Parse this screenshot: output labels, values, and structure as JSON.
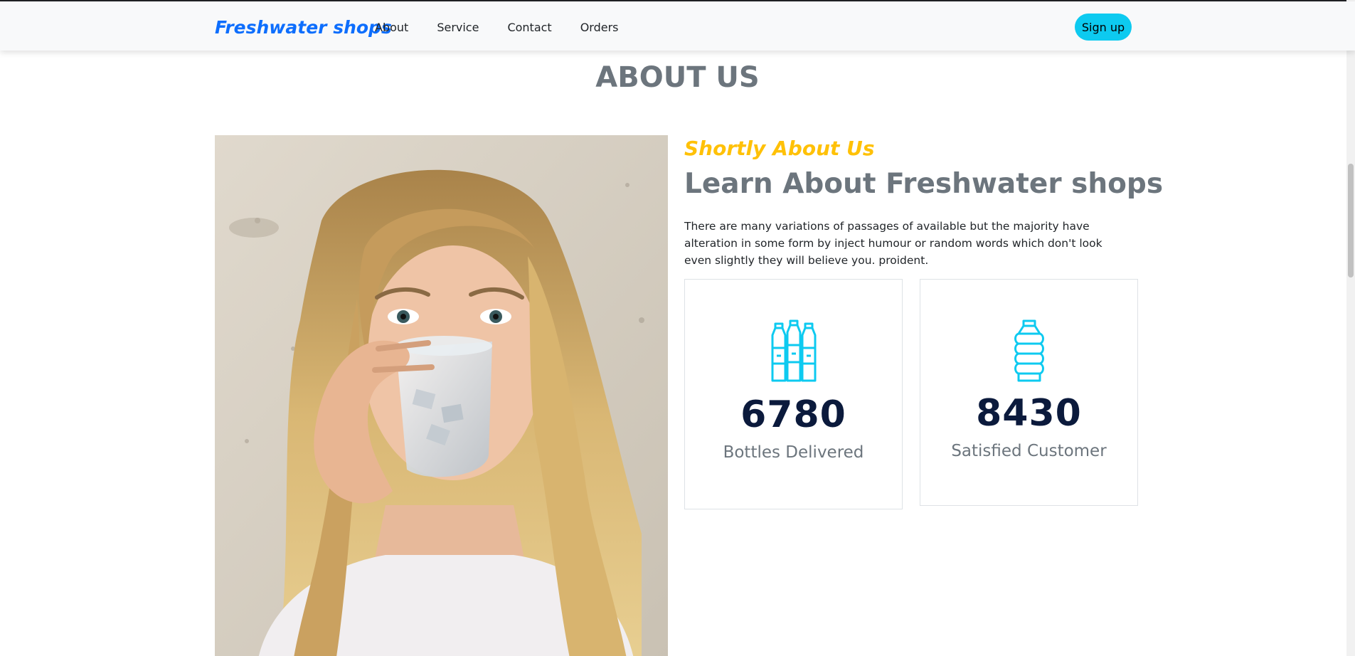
{
  "navbar": {
    "brand": "Freshwater shops",
    "links": [
      {
        "label": "About"
      },
      {
        "label": "Service"
      },
      {
        "label": "Contact"
      },
      {
        "label": "Orders"
      }
    ],
    "signup_label": "Sign up"
  },
  "about": {
    "section_title": "ABOUT US",
    "subtitle": "Shortly About Us",
    "heading": "Learn About Freshwater shops",
    "description": "There are many variations of passages of available but the majority have alteration in some form by inject humour or random words which don't look even slightly they will believe you. proident.",
    "image": {
      "name": "woman-drinking-water-photo"
    },
    "stats": [
      {
        "icon": "three-bottles-icon",
        "number": "6780",
        "label": "Bottles Delivered"
      },
      {
        "icon": "water-jug-icon",
        "number": "8430",
        "label": "Satisfied Customer"
      }
    ]
  },
  "colors": {
    "brand": "#0d6efd",
    "accent": "#0dcaf0",
    "subtitle": "#ffc107",
    "heading": "#6c757d",
    "stat_number": "#0b1a3c"
  }
}
